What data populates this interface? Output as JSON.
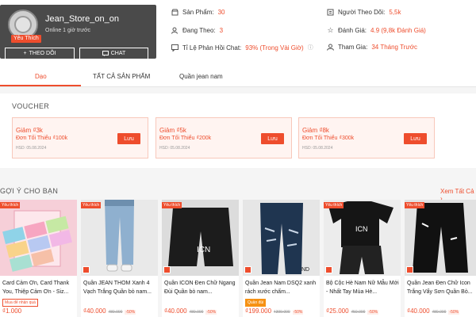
{
  "shop": {
    "name": "Jean_Store_on_on",
    "online": "Online 1 giờ trước",
    "favorite_badge": "Yêu Thích",
    "follow_label": "THEO DÕI",
    "chat_label": "CHAT"
  },
  "stats": {
    "products": {
      "label": "Sản Phẩm:",
      "value": "30"
    },
    "following": {
      "label": "Đang Theo:",
      "value": "3"
    },
    "response": {
      "label": "Tỉ Lệ Phản Hồi Chat:",
      "value": "93% (Trong Vài Giờ)"
    },
    "followers": {
      "label": "Người Theo Dõi:",
      "value": "5,5k"
    },
    "rating": {
      "label": "Đánh Giá:",
      "value": "4.9 (9,8k Đánh Giá)"
    },
    "joined": {
      "label": "Tham Gia:",
      "value": "34 Tháng Trước"
    }
  },
  "tabs": [
    "Dạo",
    "TẤT CẢ SẢN PHẨM",
    "Quần jean nam"
  ],
  "voucher_section": {
    "title": "VOUCHER",
    "items": [
      {
        "discount": "Giảm ₫3k",
        "min": "Đơn Tối Thiểu ₫100k",
        "expiry": "HSD: 05.08.2024",
        "button": "Lưu"
      },
      {
        "discount": "Giảm ₫5k",
        "min": "Đơn Tối Thiểu ₫200k",
        "expiry": "HSD: 05.08.2024",
        "button": "Lưu"
      },
      {
        "discount": "Giảm ₫8k",
        "min": "Đơn Tối Thiểu ₫300k",
        "expiry": "HSD: 05.08.2024",
        "button": "Lưu"
      }
    ]
  },
  "suggestions": {
    "title": "GỢI Ý CHO BẠN",
    "see_all": "Xem Tất Cả ›",
    "products": [
      {
        "badge": "Yêu thích",
        "name": "Card Cảm Ơn, Card Thank You, Thiệp Cảm Ơn - Siz...",
        "tag": "Mua để nhận quà",
        "price": "₫1.000",
        "old": "",
        "discount": ""
      },
      {
        "badge": "Yêu thích",
        "name": "Quần JEAN THOM Xanh 4 Vạch Trắng Quần bò nam...",
        "tag": "",
        "price": "₫40.000",
        "old": "₫80.000",
        "discount": "-50%"
      },
      {
        "badge": "Yêu thích",
        "name": "Quần ICON Đen Chữ Ngang Đùi Quần bò nam...",
        "tag": "",
        "price": "₫40.000",
        "old": "₫80.000",
        "discount": "-50%"
      },
      {
        "badge": "Yêu thích",
        "name": "Quần Jean Nam DSQ2 xanh rách xước chấm...",
        "tag": "Quần đùi",
        "price": "₫199.000",
        "old": "₫399.000",
        "discount": "-50%"
      },
      {
        "badge": "Yêu thích",
        "name": "Bộ Cộc Hè Nam Nữ Mẫu Mới - Nhất Tay Mùa Hè...",
        "tag": "",
        "price": "₫25.000",
        "old": "₫50.000",
        "discount": "-50%"
      },
      {
        "badge": "Yêu thích",
        "name": "Quần Jean Đen Chữ Icon Trắng Vẩy Sơn Quần Bò...",
        "tag": "",
        "price": "₫40.000",
        "old": "₫80.000",
        "discount": "-50%"
      }
    ]
  },
  "colors": {
    "accent": "#ee4d2d",
    "card": "#4a4a4a"
  }
}
